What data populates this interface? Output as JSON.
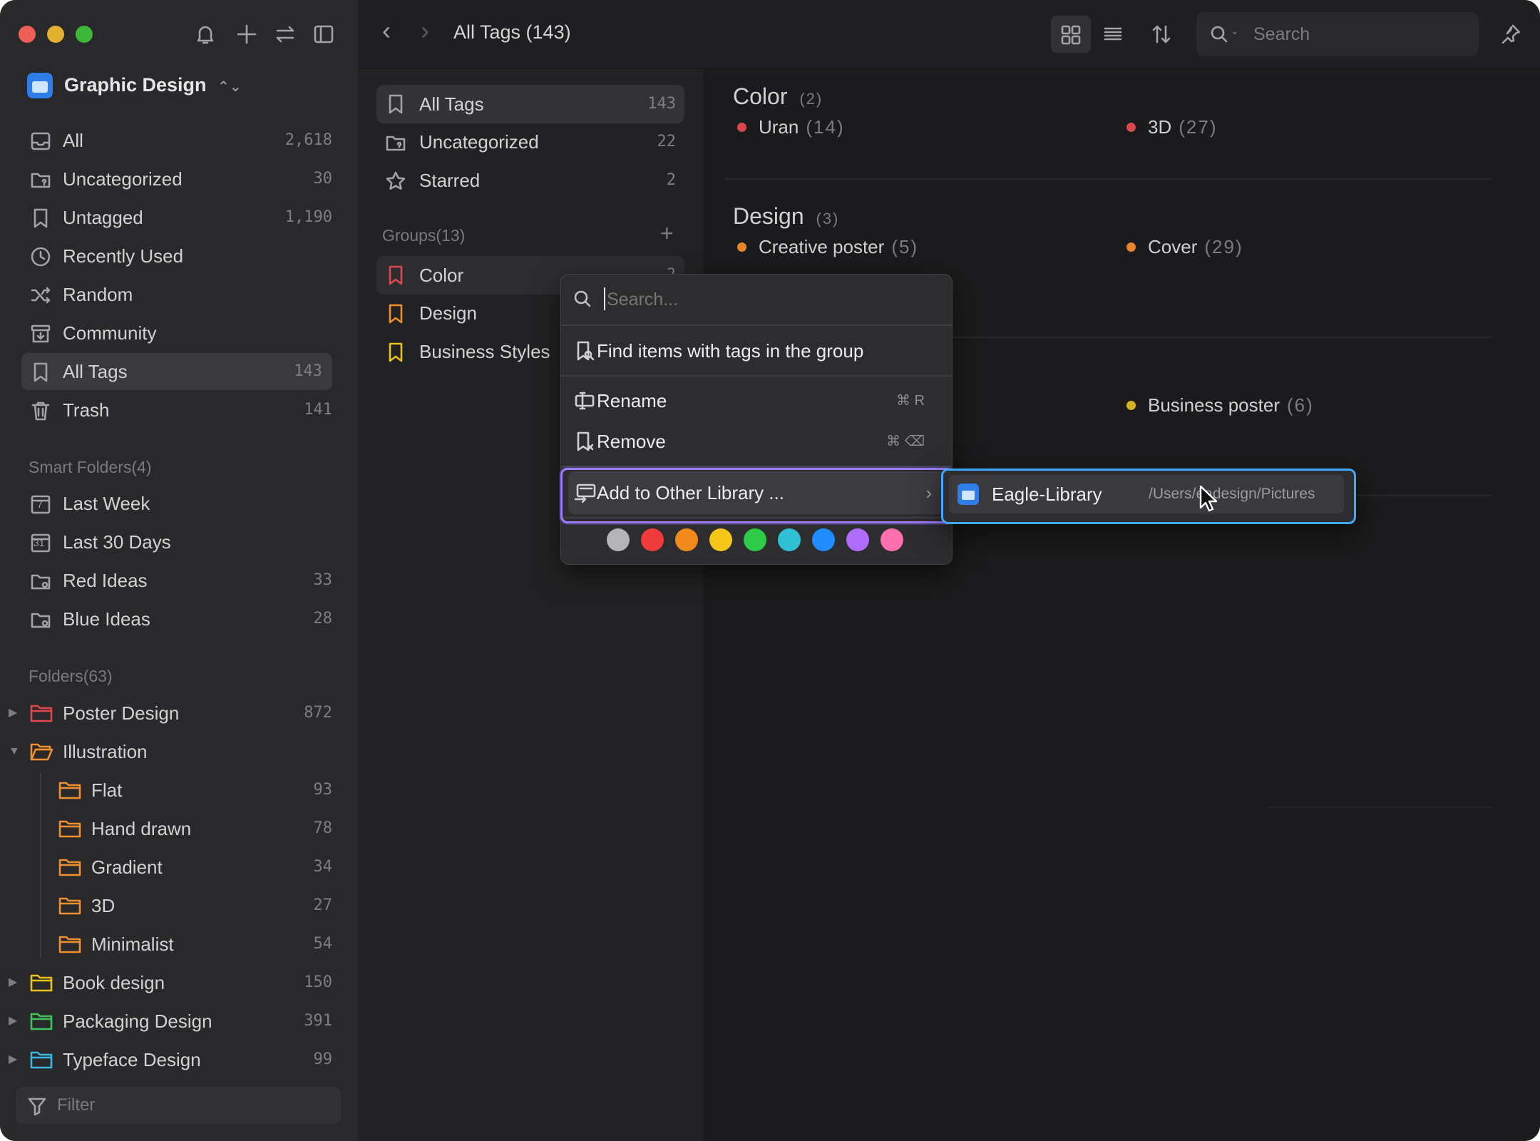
{
  "library": {
    "name": "Graphic Design"
  },
  "sidebar": {
    "nav": [
      {
        "label": "All",
        "count": "2,618"
      },
      {
        "label": "Uncategorized",
        "count": "30"
      },
      {
        "label": "Untagged",
        "count": "1,190"
      },
      {
        "label": "Recently Used",
        "count": ""
      },
      {
        "label": "Random",
        "count": ""
      },
      {
        "label": "Community",
        "count": ""
      },
      {
        "label": "All Tags",
        "count": "143"
      },
      {
        "label": "Trash",
        "count": "141"
      }
    ],
    "smart_title": "Smart Folders(4)",
    "smart": [
      {
        "label": "Last Week",
        "count": "",
        "badge": "7"
      },
      {
        "label": "Last 30 Days",
        "count": "",
        "badge": "31"
      },
      {
        "label": "Red Ideas",
        "count": "33"
      },
      {
        "label": "Blue Ideas",
        "count": "28"
      }
    ],
    "folders_title": "Folders(63)",
    "folders": [
      {
        "label": "Poster Design",
        "count": "872",
        "color": "#e0474c"
      },
      {
        "label": "Illustration",
        "count": "",
        "color": "#f0902c"
      },
      {
        "label": "Flat",
        "count": "93",
        "color": "#f0902c"
      },
      {
        "label": "Hand drawn",
        "count": "78",
        "color": "#f0902c"
      },
      {
        "label": "Gradient",
        "count": "34",
        "color": "#f0902c"
      },
      {
        "label": "3D",
        "count": "27",
        "color": "#f0902c"
      },
      {
        "label": "Minimalist",
        "count": "54",
        "color": "#f0902c"
      },
      {
        "label": "Book design",
        "count": "150",
        "color": "#e8c41a"
      },
      {
        "label": "Packaging Design",
        "count": "391",
        "color": "#3fc25a"
      },
      {
        "label": "Typeface Design",
        "count": "99",
        "color": "#3ab7e0"
      }
    ],
    "filter_placeholder": "Filter"
  },
  "topbar": {
    "title": "All Tags (143)",
    "search_placeholder": "Search"
  },
  "tagpanel": {
    "items": [
      {
        "label": "All Tags",
        "count": "143"
      },
      {
        "label": "Uncategorized",
        "count": "22"
      },
      {
        "label": "Starred",
        "count": "2"
      }
    ],
    "groups_title": "Groups(13)",
    "groups": [
      {
        "label": "Color",
        "count": "2",
        "color": "#e0474c"
      },
      {
        "label": "Design",
        "count": "",
        "color": "#f0902c"
      },
      {
        "label": "Business Styles",
        "count": "",
        "color": "#e8c41a"
      }
    ]
  },
  "content": {
    "sections": [
      {
        "title": "Color",
        "count": "(2)",
        "tags": [
          {
            "name": "Uran",
            "count": "(14)",
            "color": "#d8474c"
          },
          {
            "name": "3D",
            "count": "(27)",
            "color": "#d8474c"
          }
        ]
      },
      {
        "title": "Design",
        "count": "(3)",
        "tags": [
          {
            "name": "Creative poster",
            "count": "(5)",
            "color": "#e8842c"
          },
          {
            "name": "Cover",
            "count": "(29)",
            "color": "#e8842c"
          },
          {
            "name": "Business poster",
            "count": "(6)",
            "color": "#d6b21e"
          }
        ]
      }
    ]
  },
  "context_menu": {
    "search_placeholder": "Search...",
    "find": "Find items with tags in the group",
    "rename": "Rename",
    "rename_shortcut": "⌘ R",
    "remove": "Remove",
    "remove_shortcut": "⌘ ⌫",
    "add_other": "Add to Other Library ...",
    "colors": [
      "#b4b4b8",
      "#ef3b3b",
      "#f08a1c",
      "#f5c518",
      "#2ecb48",
      "#30c0d6",
      "#1f8cff",
      "#b06cff",
      "#ff6fb0"
    ]
  },
  "submenu": {
    "library": "Eagle-Library",
    "path": "/Users/eadesign/Pictures"
  }
}
